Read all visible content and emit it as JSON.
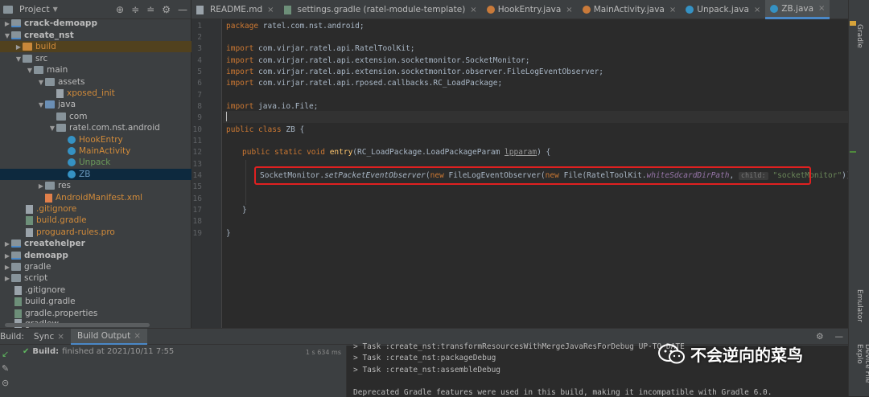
{
  "project_panel": {
    "title": "Project",
    "tree": [
      {
        "label": "crack-demoapp",
        "bold": true
      },
      {
        "label": "create_nst",
        "bold": true
      },
      {
        "label": "build"
      },
      {
        "label": "src"
      },
      {
        "label": "main"
      },
      {
        "label": "assets"
      },
      {
        "label": "xposed_init"
      },
      {
        "label": "java"
      },
      {
        "label": "com"
      },
      {
        "label": "ratel.com.nst.android"
      },
      {
        "label": "HookEntry"
      },
      {
        "label": "MainActivity"
      },
      {
        "label": "Unpack"
      },
      {
        "label": "ZB"
      },
      {
        "label": "res"
      },
      {
        "label": "AndroidManifest.xml"
      },
      {
        "label": ".gitignore"
      },
      {
        "label": "build.gradle"
      },
      {
        "label": "proguard-rules.pro"
      },
      {
        "label": "createhelper",
        "bold": true
      },
      {
        "label": "demoapp",
        "bold": true
      },
      {
        "label": "gradle"
      },
      {
        "label": "script"
      },
      {
        "label": ".gitignore"
      },
      {
        "label": "build.gradle"
      },
      {
        "label": "gradle.properties"
      },
      {
        "label": "gradlew"
      }
    ]
  },
  "editor_tabs": [
    {
      "label": "README.md"
    },
    {
      "label": "settings.gradle (ratel-module-template)"
    },
    {
      "label": "HookEntry.java"
    },
    {
      "label": "MainActivity.java"
    },
    {
      "label": "Unpack.java"
    },
    {
      "label": "ZB.java"
    }
  ],
  "code": {
    "line_numbers": [
      "1",
      "2",
      "3",
      "4",
      "5",
      "6",
      "7",
      "8",
      "9",
      "10",
      "11",
      "12",
      "13",
      "14",
      "15",
      "16",
      "17",
      "18",
      "19"
    ],
    "l1_kw": "package",
    "l1_rest": " ratel.com.nst.android;",
    "imp": "import",
    "l3": " com.virjar.ratel.api.RatelToolKit;",
    "l4": " com.virjar.ratel.api.extension.socketmonitor.SocketMonitor;",
    "l5": " com.virjar.ratel.api.extension.socketmonitor.observer.FileLogEventObserver;",
    "l6": " com.virjar.ratel.api.rposed.callbacks.RC_LoadPackage;",
    "l8": " java.io.File;",
    "l10_kw": "public class",
    "l10_rest": " ZB {",
    "l12_kw": "public static void",
    "l12_fn": "entry",
    "l12_mid": "(RC_LoadPackage.LoadPackageParam ",
    "l12_param": "lpparam",
    "l12_end": ") {",
    "l14_a": "SocketMonitor.",
    "l14_method": "setPacketEventObserver",
    "l14_b": "(",
    "l14_new1": "new",
    "l14_c": " FileLogEventObserver(",
    "l14_new2": "new",
    "l14_d": " File(RatelToolKit.",
    "l14_field": "whiteSdcardDirPath",
    "l14_e": ", ",
    "l14_hint": "child:",
    "l14_str": "\"socketMonitor\"",
    "l14_f": ")));",
    "l17": "}",
    "l19": "}"
  },
  "right_bar": {
    "gradle": "Gradle",
    "emulator": "Emulator",
    "device": "Device File Explo"
  },
  "bottom": {
    "build_label": "Build:",
    "tabs": [
      "Sync",
      "Build Output"
    ],
    "status_bold": "Build:",
    "status_text": " finished at 2021/10/11 7:55",
    "duration": "1 s 634 ms",
    "output": [
      "> Task :create_nst:transformResourcesWithMergeJavaResForDebug UP-TO-DATE",
      "> Task :create_nst:packageDebug",
      "> Task :create_nst:assembleDebug",
      "",
      "Deprecated Gradle features were used in this build, making it incompatible with Gradle 6.0."
    ]
  },
  "watermark": "不会逆向的菜鸟"
}
